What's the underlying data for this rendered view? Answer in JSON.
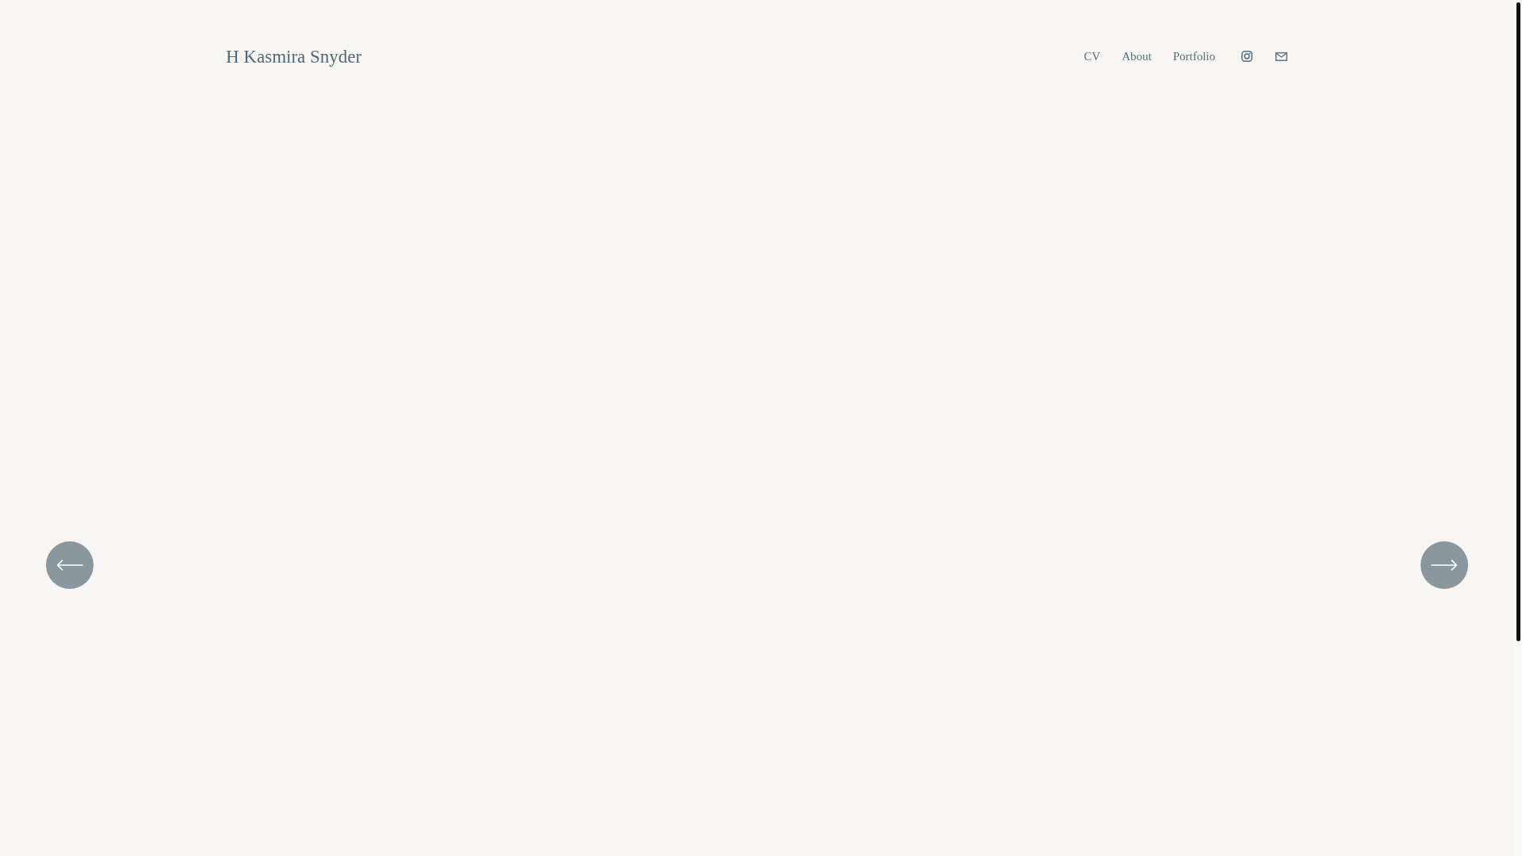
{
  "header": {
    "site_title": "H Kasmira Snyder",
    "nav_links": [
      {
        "label": "CV"
      },
      {
        "label": "About"
      },
      {
        "label": "Portfolio"
      }
    ]
  }
}
